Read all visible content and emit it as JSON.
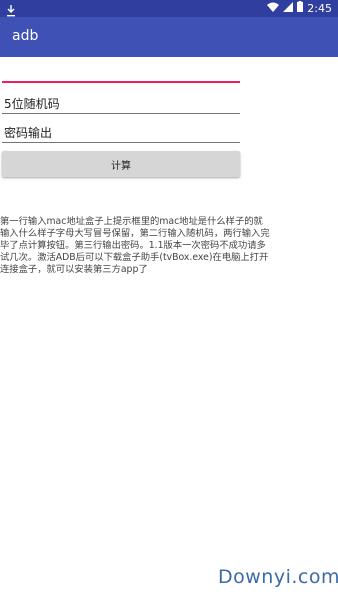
{
  "status_bar": {
    "time": "2:45"
  },
  "app_bar": {
    "title": "adb",
    "color": "#3f51b5",
    "status_color": "#303f9f"
  },
  "form": {
    "mac_input": {
      "value": ""
    },
    "random_code_input": {
      "value": "5位随机码"
    },
    "password_output": {
      "value": "密码输出"
    },
    "calculate_label": "计算"
  },
  "description": "第一行输入mac地址盒子上提示框里的mac地址是什么样子的就输入什么样子字母大写冒号保留，第二行输入随机码，两行输入完毕了点计算按钮。第三行输出密码。1.1版本一次密码不成功请多试几次。激活ADB后可以下载盒子助手(tvBox.exe)在电脑上打开连接盒子，就可以安装第三方app了",
  "watermark": "Downyi.com",
  "icons": [
    "download-icon",
    "wifi-icon",
    "signal-icon",
    "battery-icon"
  ]
}
